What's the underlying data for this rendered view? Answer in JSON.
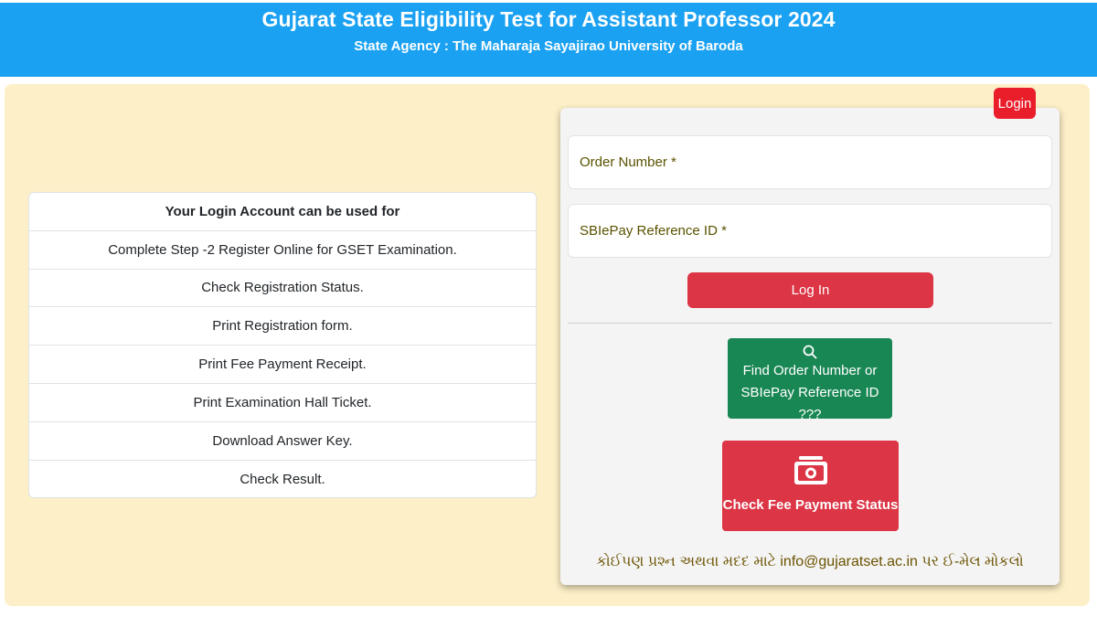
{
  "header": {
    "title": "Gujarat State Eligibility Test for Assistant Professor 2024",
    "subtitle": "State Agency : The Maharaja Sayajirao University of Baroda"
  },
  "info": {
    "heading": "Your Login Account can be used for",
    "items": [
      "Complete Step -2 Register Online for GSET Examination.",
      "Check Registration Status.",
      "Print Registration form.",
      "Print Fee Payment Receipt.",
      "Print Examination Hall Ticket.",
      "Download Answer Key.",
      "Check Result."
    ]
  },
  "login": {
    "badge": "Login",
    "order_label": "Order Number *",
    "sbi_label": "SBIePay Reference ID *",
    "button": "Log In",
    "find_line1": "Find Order Number or",
    "find_line2": "SBIePay Reference ID ???",
    "fee_button": "Check Fee Payment Status",
    "help": "કોઈપણ પ્રશ્ન અથવા મદદ માટે info@gujaratset.ac.in પર ઈ-મેલ મોકલો"
  },
  "colors": {
    "header_bg": "#1ba1f2",
    "main_bg": "#fdf0c8",
    "danger": "#dc3545",
    "success": "#198754",
    "badge": "#ea1d2a"
  },
  "icons": {
    "find": "search-icon",
    "fee": "money-bill-icon"
  }
}
